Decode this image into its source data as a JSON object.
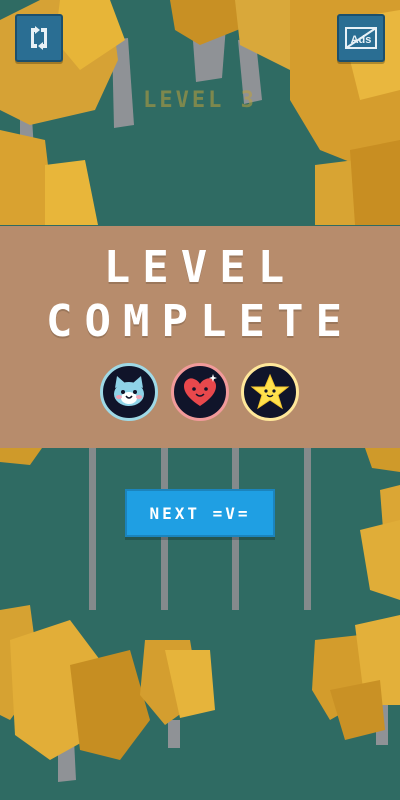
{
  "hud": {
    "restart_icon": "restart-arrows-icon",
    "no_ads_icon": "no-ads-icon",
    "no_ads_label": "Ads",
    "level_label": "LEVEL 3"
  },
  "result_panel": {
    "title_line_1": "LEVEL",
    "title_line_2": "COMPLETE",
    "badges": [
      {
        "icon": "cat-face-icon",
        "ring_color": "#9fd9e6"
      },
      {
        "icon": "heart-face-icon",
        "ring_color": "#f19a9a"
      },
      {
        "icon": "star-icon",
        "ring_color": "#ffe79a"
      }
    ],
    "background_color": "#b78c6c"
  },
  "next_button": {
    "label": "NEXT =V=",
    "color": "#1f9fe3"
  }
}
